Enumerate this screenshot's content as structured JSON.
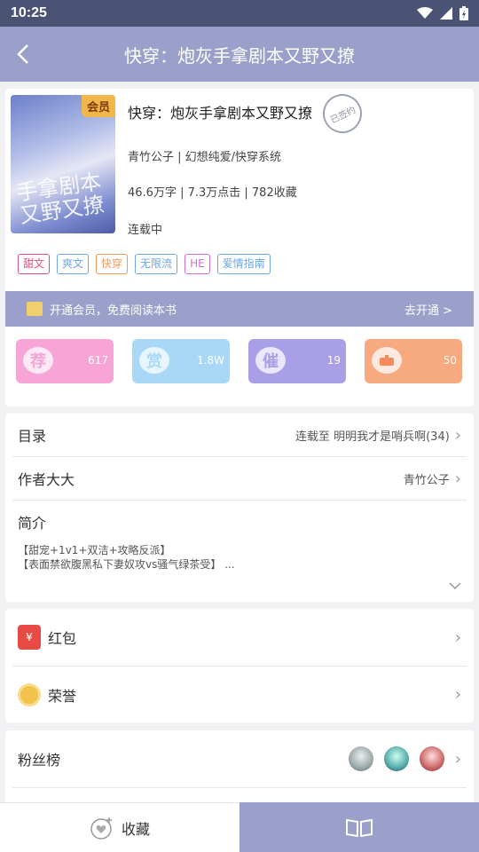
{
  "status": {
    "time": "10:25"
  },
  "appbar": {
    "title": "快穿：炮灰手拿剧本又野又撩"
  },
  "book": {
    "badge": "会员",
    "cover_text": "手拿剧本又野又撩",
    "title": "快穿：炮灰手拿剧本又野又撩",
    "stamp": "已签约",
    "author_genre": "青竹公子 | 幻想纯爱/快穿系统",
    "stats": "46.6万字 | 7.3万点击 | 782收藏",
    "state": "连载中",
    "tags": [
      {
        "label": "甜文",
        "color": "#e0517a"
      },
      {
        "label": "爽文",
        "color": "#6aa6e8"
      },
      {
        "label": "快穿",
        "color": "#f09a5a"
      },
      {
        "label": "无限流",
        "color": "#6aa6e8"
      },
      {
        "label": "HE",
        "color": "#d36cd0"
      },
      {
        "label": "爱情指南",
        "color": "#6aa6e8"
      }
    ]
  },
  "vip": {
    "text": "开通会员，免费阅读本书",
    "action": "去开通 >"
  },
  "actions": [
    {
      "icon": "荐",
      "count": "617",
      "color": "#f7a5d7"
    },
    {
      "icon": "赏",
      "count": "1.8W",
      "color": "#a9d8f7"
    },
    {
      "icon": "催",
      "count": "19",
      "color": "#a99fe6"
    },
    {
      "icon": "gift",
      "count": "50",
      "color": "#f7a97f"
    }
  ],
  "toc": {
    "label": "目录",
    "value": "连载至 明明我才是哨兵啊(34)"
  },
  "author": {
    "label": "作者大大",
    "value": "青竹公子"
  },
  "intro": {
    "label": "简介",
    "line1": "【甜宠+1v1+双洁+攻略反派】",
    "line2": "【表面禁欲腹黑私下妻奴攻vs骚气绿茶受】 ..."
  },
  "redpacket": {
    "label": "红包",
    "icon_char": "¥"
  },
  "honor": {
    "label": "荣誉"
  },
  "fans": {
    "label": "粉丝榜"
  },
  "bottom": {
    "collect": "收藏"
  }
}
